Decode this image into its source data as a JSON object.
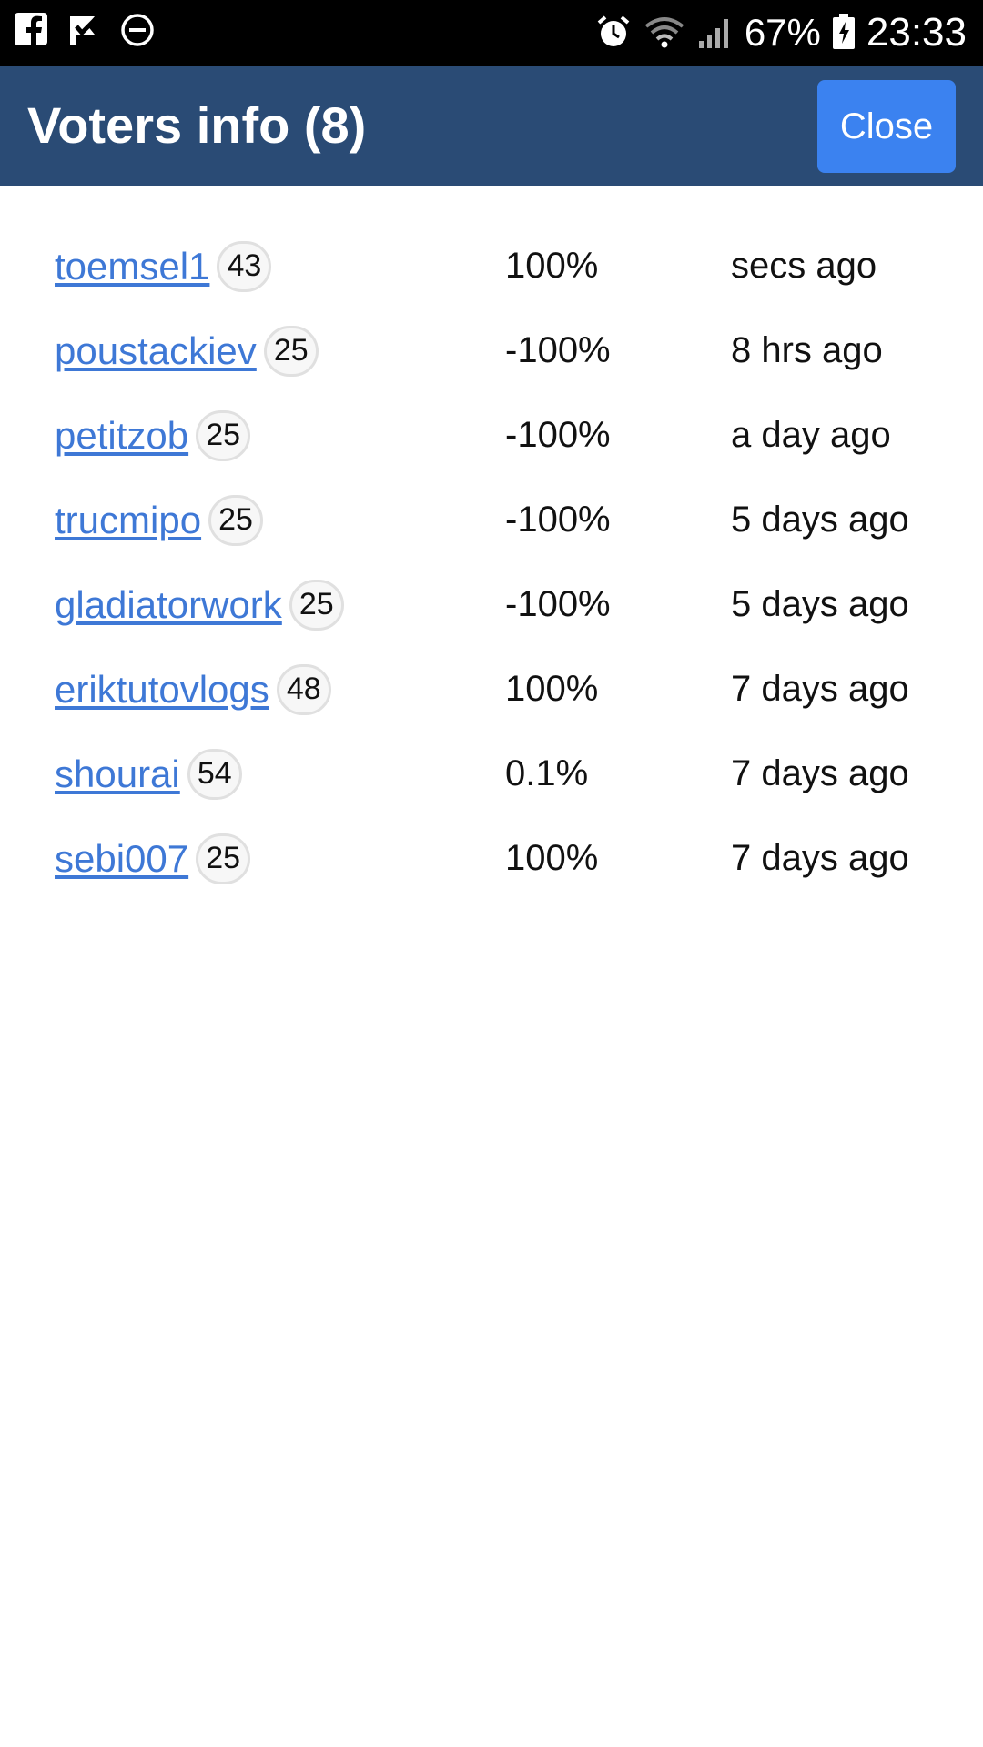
{
  "status_bar": {
    "battery": "67%",
    "time": "23:33",
    "icons": [
      "facebook-icon",
      "check-flag-icon",
      "do-not-disturb-icon",
      "alarm-icon",
      "wifi-icon",
      "signal-icon",
      "battery-icon"
    ]
  },
  "header": {
    "title": "Voters info (8)",
    "close_label": "Close",
    "background": "#2a4b75",
    "button_color": "#3b82f0"
  },
  "voters": [
    {
      "name": "toemsel1",
      "rep": "43",
      "percent": "100%",
      "time": "secs ago"
    },
    {
      "name": "poustackiev",
      "rep": "25",
      "percent": "-100%",
      "time": "8 hrs ago"
    },
    {
      "name": "petitzob",
      "rep": "25",
      "percent": "-100%",
      "time": "a day ago"
    },
    {
      "name": "trucmipo",
      "rep": "25",
      "percent": "-100%",
      "time": "5 days ago"
    },
    {
      "name": "gladiatorwork",
      "rep": "25",
      "percent": "-100%",
      "time": "5 days ago"
    },
    {
      "name": "eriktutovlogs",
      "rep": "48",
      "percent": "100%",
      "time": "7 days ago"
    },
    {
      "name": "shourai",
      "rep": "54",
      "percent": "0.1%",
      "time": "7 days ago"
    },
    {
      "name": "sebi007",
      "rep": "25",
      "percent": "100%",
      "time": "7 days ago"
    }
  ],
  "link_color": "#3e78d6"
}
